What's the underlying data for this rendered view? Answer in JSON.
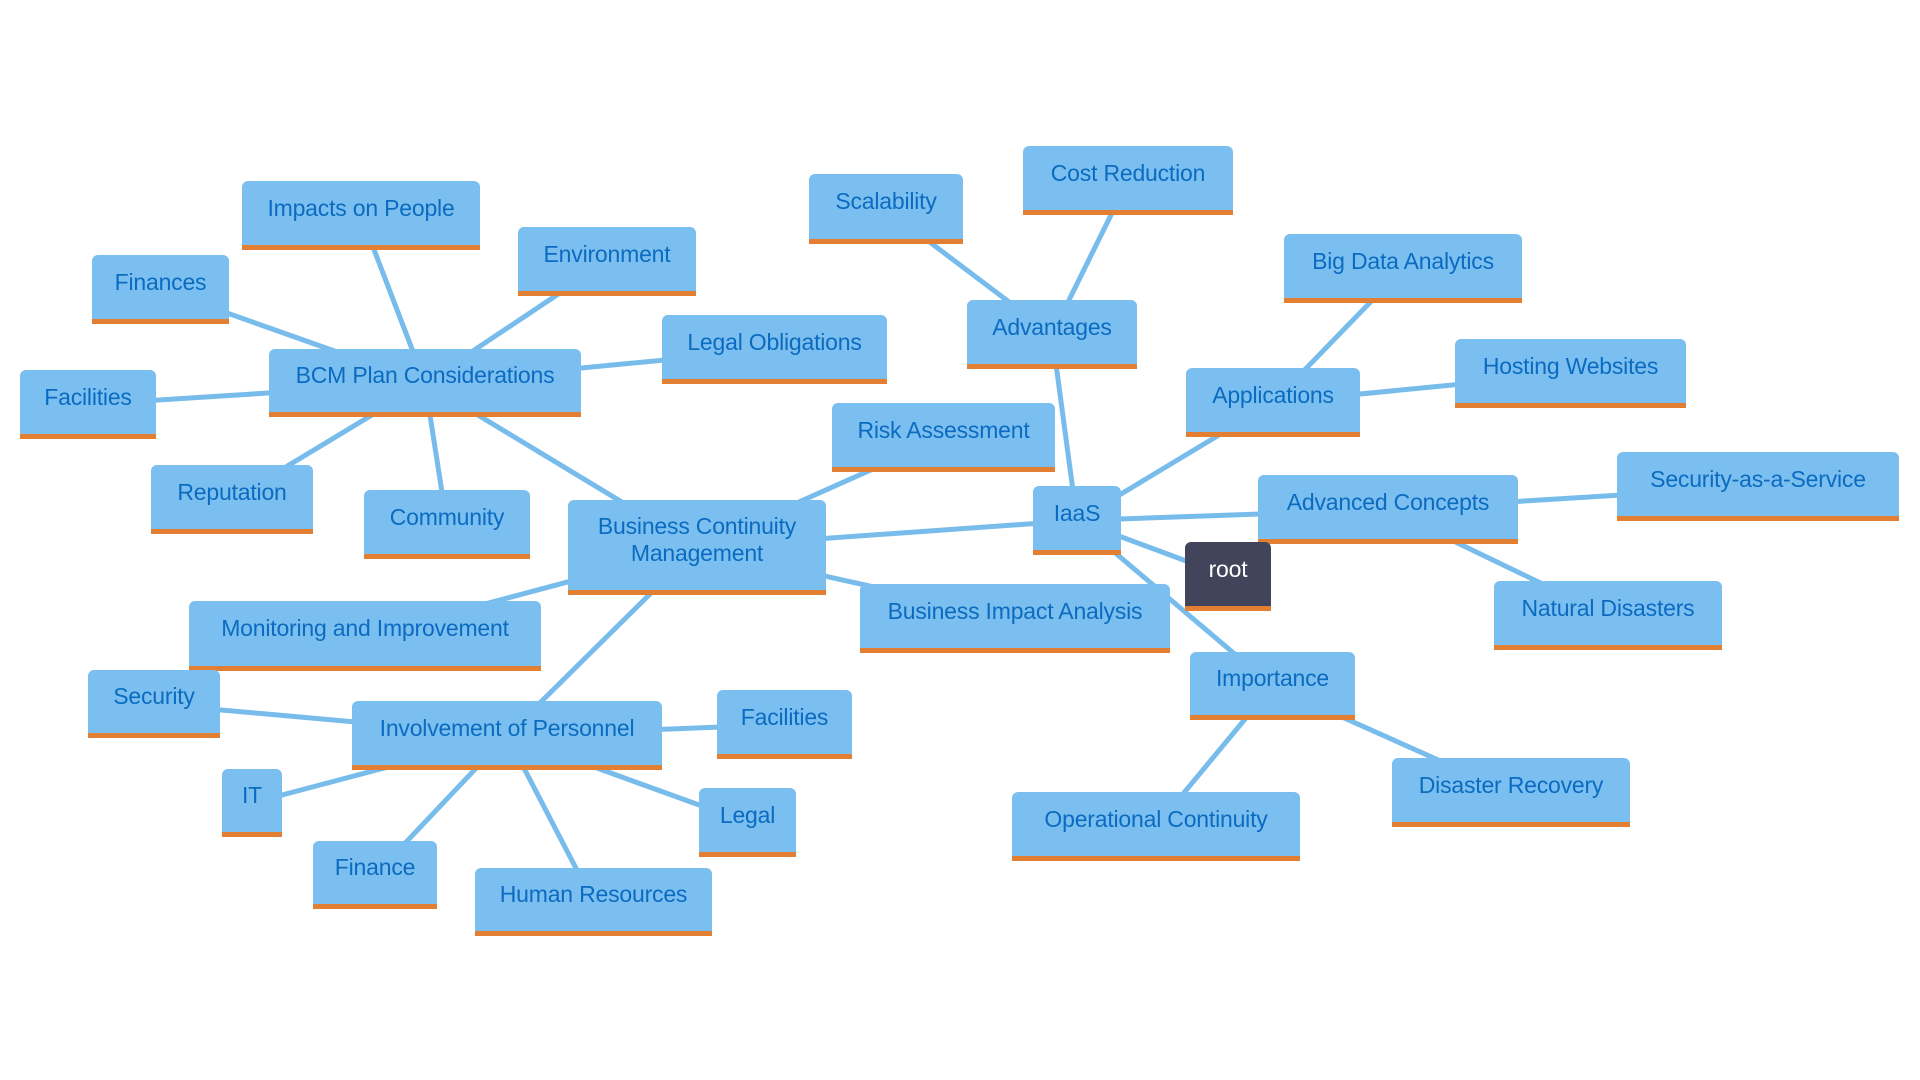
{
  "colors": {
    "node_bg": "#7bbff0",
    "node_text": "#0b6bc0",
    "accent": "#e37f33",
    "edge": "#78bcec",
    "root_bg": "#41445a",
    "root_text": "#ffffff",
    "background": "#ffffff"
  },
  "nodes": [
    {
      "id": "bcm",
      "label": "Business Continuity\nManagement"
    },
    {
      "id": "bcm-plan",
      "label": "BCM Plan Considerations"
    },
    {
      "id": "impacts-people",
      "label": "Impacts on People"
    },
    {
      "id": "environment",
      "label": "Environment"
    },
    {
      "id": "finances",
      "label": "Finances"
    },
    {
      "id": "legal-obligations",
      "label": "Legal Obligations"
    },
    {
      "id": "facilities-plan",
      "label": "Facilities"
    },
    {
      "id": "reputation",
      "label": "Reputation"
    },
    {
      "id": "community",
      "label": "Community"
    },
    {
      "id": "risk-assessment",
      "label": "Risk Assessment"
    },
    {
      "id": "monitoring",
      "label": "Monitoring and Improvement"
    },
    {
      "id": "bia",
      "label": "Business Impact Analysis"
    },
    {
      "id": "involvement",
      "label": "Involvement of Personnel"
    },
    {
      "id": "security",
      "label": "Security"
    },
    {
      "id": "facilities-personnel",
      "label": "Facilities"
    },
    {
      "id": "it",
      "label": "IT"
    },
    {
      "id": "legal",
      "label": "Legal"
    },
    {
      "id": "finance",
      "label": "Finance"
    },
    {
      "id": "human-resources",
      "label": "Human Resources"
    },
    {
      "id": "iaas",
      "label": "IaaS"
    },
    {
      "id": "advantages",
      "label": "Advantages"
    },
    {
      "id": "scalability",
      "label": "Scalability"
    },
    {
      "id": "cost-reduction",
      "label": "Cost Reduction"
    },
    {
      "id": "applications",
      "label": "Applications"
    },
    {
      "id": "big-data",
      "label": "Big Data Analytics"
    },
    {
      "id": "hosting",
      "label": "Hosting Websites"
    },
    {
      "id": "advanced",
      "label": "Advanced Concepts"
    },
    {
      "id": "saas",
      "label": "Security-as-a-Service"
    },
    {
      "id": "natural-disasters",
      "label": "Natural Disasters"
    },
    {
      "id": "root",
      "label": "root"
    },
    {
      "id": "importance",
      "label": "Importance"
    },
    {
      "id": "operational-continuity",
      "label": "Operational Continuity"
    },
    {
      "id": "disaster-recovery",
      "label": "Disaster Recovery"
    }
  ],
  "edges": [
    [
      "bcm-plan",
      "impacts-people"
    ],
    [
      "bcm-plan",
      "environment"
    ],
    [
      "bcm-plan",
      "finances"
    ],
    [
      "bcm-plan",
      "legal-obligations"
    ],
    [
      "bcm-plan",
      "facilities-plan"
    ],
    [
      "bcm-plan",
      "reputation"
    ],
    [
      "bcm-plan",
      "community"
    ],
    [
      "bcm",
      "bcm-plan"
    ],
    [
      "bcm",
      "risk-assessment"
    ],
    [
      "bcm",
      "monitoring"
    ],
    [
      "bcm",
      "bia"
    ],
    [
      "bcm",
      "involvement"
    ],
    [
      "bcm",
      "iaas"
    ],
    [
      "involvement",
      "security"
    ],
    [
      "involvement",
      "facilities-personnel"
    ],
    [
      "involvement",
      "it"
    ],
    [
      "involvement",
      "legal"
    ],
    [
      "involvement",
      "finance"
    ],
    [
      "involvement",
      "human-resources"
    ],
    [
      "iaas",
      "advantages"
    ],
    [
      "iaas",
      "applications"
    ],
    [
      "iaas",
      "advanced"
    ],
    [
      "iaas",
      "root"
    ],
    [
      "iaas",
      "importance"
    ],
    [
      "advantages",
      "scalability"
    ],
    [
      "advantages",
      "cost-reduction"
    ],
    [
      "applications",
      "big-data"
    ],
    [
      "applications",
      "hosting"
    ],
    [
      "advanced",
      "saas"
    ],
    [
      "advanced",
      "natural-disasters"
    ],
    [
      "importance",
      "operational-continuity"
    ],
    [
      "importance",
      "disaster-recovery"
    ]
  ]
}
